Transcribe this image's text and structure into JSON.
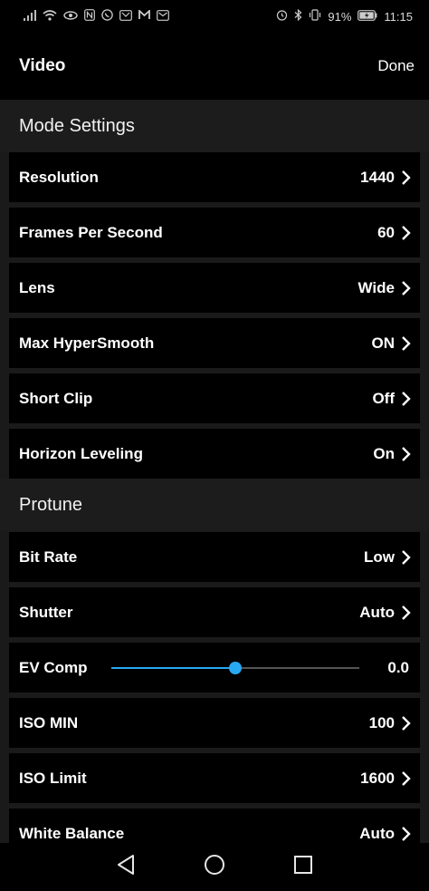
{
  "status_bar": {
    "battery": "91%",
    "time": "11:15"
  },
  "header": {
    "title": "Video",
    "done_label": "Done"
  },
  "sections": {
    "mode": {
      "title": "Mode Settings",
      "rows": [
        {
          "label": "Resolution",
          "value": "1440"
        },
        {
          "label": "Frames Per Second",
          "value": "60"
        },
        {
          "label": "Lens",
          "value": "Wide"
        },
        {
          "label": "Max HyperSmooth",
          "value": "ON"
        },
        {
          "label": "Short Clip",
          "value": "Off"
        },
        {
          "label": "Horizon Leveling",
          "value": "On"
        }
      ]
    },
    "protune": {
      "title": "Protune",
      "rows": [
        {
          "label": "Bit Rate",
          "value": "Low"
        },
        {
          "label": "Shutter",
          "value": "Auto"
        },
        {
          "label": "EV Comp",
          "value": "0.0",
          "slider_fraction": 0.5
        },
        {
          "label": "ISO MIN",
          "value": "100"
        },
        {
          "label": "ISO Limit",
          "value": "1600"
        },
        {
          "label": "White Balance",
          "value": "Auto"
        }
      ]
    }
  },
  "colors": {
    "accent": "#29a8f2",
    "row_bg": "#000000",
    "section_bg": "#1c1c1c"
  }
}
